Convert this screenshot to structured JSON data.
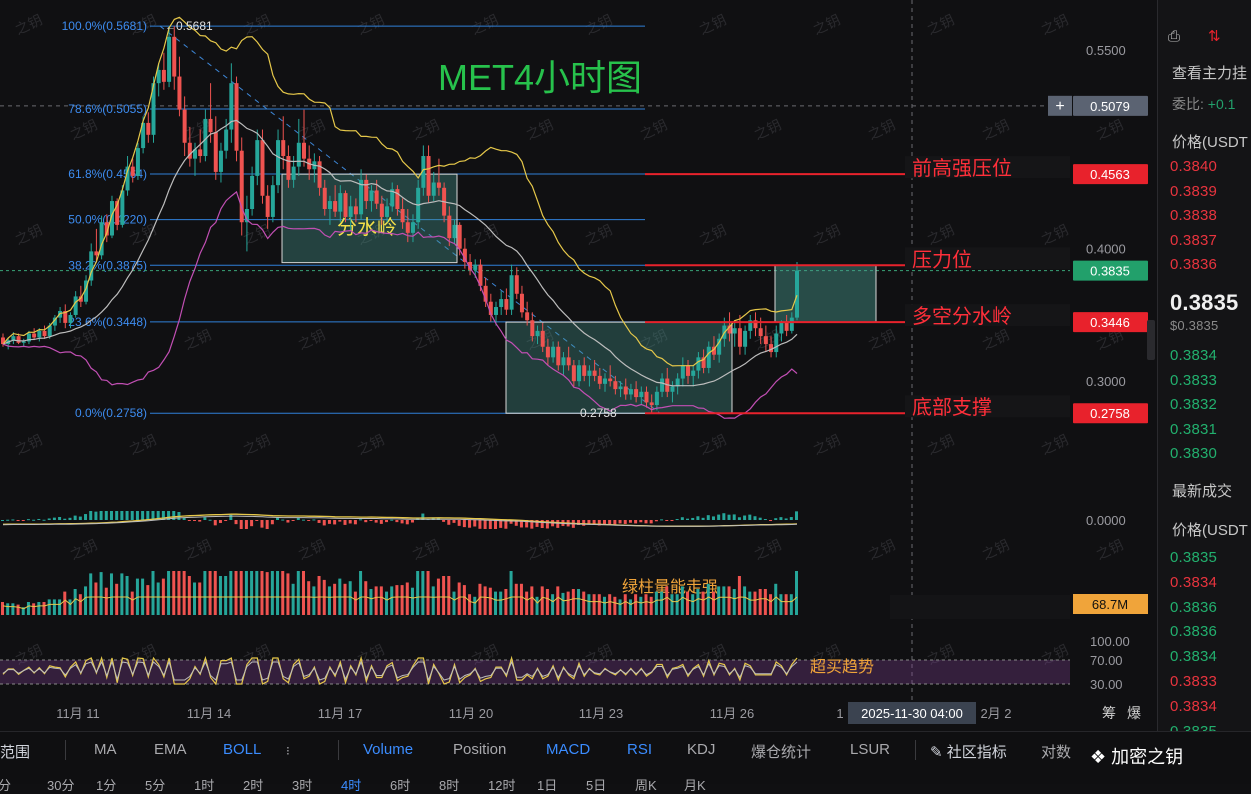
{
  "chart_data": {
    "type": "candlestick",
    "title": "MET4小时图",
    "y_axis": {
      "range": [
        0.2556,
        0.5742
      ],
      "tick_labels": [
        "0.5500",
        "0.4000",
        "0.3000"
      ],
      "ticks": [
        0.55,
        0.4,
        0.3
      ]
    },
    "x_axis": {
      "tick_labels": [
        "11月 11",
        "11月 14",
        "11月 17",
        "11月 20",
        "11月 23",
        "11月 26",
        "1",
        "2月 2"
      ],
      "crosshair_label": "2025-11-30 04:00"
    },
    "price_tags": [
      {
        "value": 0.5079,
        "label": "0.5079",
        "color": "#5b6372"
      },
      {
        "value": 0.4563,
        "label": "0.4563",
        "color": "#e8222c"
      },
      {
        "value": 0.3835,
        "label": "0.3835",
        "color": "#22a06b"
      },
      {
        "value": 0.3446,
        "label": "0.3446",
        "color": "#e8222c"
      },
      {
        "value": 0.2758,
        "label": "0.2758",
        "color": "#e8222c"
      }
    ],
    "fibonacci": [
      {
        "ratio": "100.0%",
        "value": 0.5681,
        "label": "100.0%(0.5681)"
      },
      {
        "ratio": "78.6%",
        "value": 0.5055,
        "label": "78.6%(0.5055)"
      },
      {
        "ratio": "61.8%",
        "value": 0.4564,
        "label": "61.8%(0.4564)"
      },
      {
        "ratio": "50.0%",
        "value": 0.422,
        "label": "50.0%(0.4220)"
      },
      {
        "ratio": "38.2%",
        "value": 0.3875,
        "label": "38.2%(0.3875)"
      },
      {
        "ratio": "23.6%",
        "value": 0.3448,
        "label": "23.6%(0.3448)"
      },
      {
        "ratio": "0.0%",
        "value": 0.2758,
        "label": "0.0%(0.2758)"
      }
    ],
    "high_marker": {
      "value": 0.5681,
      "label": "0.5681"
    },
    "low_marker": {
      "value": 0.2758,
      "label": "0.2758"
    },
    "levels": [
      {
        "value": 0.4563,
        "label": "前高强压位"
      },
      {
        "value": 0.3875,
        "label": "压力位"
      },
      {
        "value": 0.3446,
        "label": "多空分水岭"
      },
      {
        "value": 0.2758,
        "label": "底部支撑"
      }
    ],
    "boxes": [
      {
        "label": "分水岭",
        "y_top": 0.4563,
        "y_bottom": 0.3895
      },
      {
        "label": "",
        "y_top": 0.3446,
        "y_bottom": 0.2758
      },
      {
        "label": "",
        "y_top": 0.3875,
        "y_bottom": 0.3446
      }
    ],
    "candles_ohlc": [
      [
        0.333,
        0.336,
        0.326,
        0.328
      ],
      [
        0.328,
        0.333,
        0.324,
        0.331
      ],
      [
        0.331,
        0.337,
        0.328,
        0.334
      ],
      [
        0.334,
        0.336,
        0.328,
        0.329
      ],
      [
        0.329,
        0.332,
        0.326,
        0.33
      ],
      [
        0.33,
        0.338,
        0.328,
        0.336
      ],
      [
        0.336,
        0.34,
        0.331,
        0.333
      ],
      [
        0.333,
        0.34,
        0.33,
        0.338
      ],
      [
        0.338,
        0.342,
        0.332,
        0.334
      ],
      [
        0.334,
        0.344,
        0.332,
        0.342
      ],
      [
        0.342,
        0.35,
        0.338,
        0.348
      ],
      [
        0.348,
        0.356,
        0.344,
        0.353
      ],
      [
        0.353,
        0.358,
        0.34,
        0.344
      ],
      [
        0.344,
        0.352,
        0.34,
        0.35
      ],
      [
        0.35,
        0.368,
        0.348,
        0.364
      ],
      [
        0.364,
        0.372,
        0.356,
        0.36
      ],
      [
        0.36,
        0.38,
        0.358,
        0.376
      ],
      [
        0.376,
        0.404,
        0.372,
        0.398
      ],
      [
        0.398,
        0.415,
        0.39,
        0.395
      ],
      [
        0.395,
        0.425,
        0.392,
        0.42
      ],
      [
        0.42,
        0.426,
        0.405,
        0.41
      ],
      [
        0.41,
        0.44,
        0.408,
        0.436
      ],
      [
        0.436,
        0.438,
        0.414,
        0.418
      ],
      [
        0.418,
        0.448,
        0.416,
        0.444
      ],
      [
        0.444,
        0.47,
        0.44,
        0.462
      ],
      [
        0.462,
        0.468,
        0.45,
        0.455
      ],
      [
        0.455,
        0.48,
        0.452,
        0.476
      ],
      [
        0.476,
        0.5,
        0.472,
        0.495
      ],
      [
        0.495,
        0.503,
        0.48,
        0.486
      ],
      [
        0.486,
        0.53,
        0.48,
        0.525
      ],
      [
        0.525,
        0.54,
        0.515,
        0.535
      ],
      [
        0.535,
        0.548,
        0.52,
        0.526
      ],
      [
        0.526,
        0.568,
        0.522,
        0.56
      ],
      [
        0.56,
        0.568,
        0.52,
        0.53
      ],
      [
        0.53,
        0.545,
        0.5,
        0.505
      ],
      [
        0.505,
        0.515,
        0.47,
        0.48
      ],
      [
        0.48,
        0.492,
        0.462,
        0.468
      ],
      [
        0.468,
        0.48,
        0.455,
        0.475
      ],
      [
        0.475,
        0.49,
        0.465,
        0.47
      ],
      [
        0.47,
        0.505,
        0.466,
        0.498
      ],
      [
        0.498,
        0.525,
        0.48,
        0.488
      ],
      [
        0.488,
        0.5,
        0.452,
        0.458
      ],
      [
        0.458,
        0.48,
        0.45,
        0.474
      ],
      [
        0.474,
        0.498,
        0.468,
        0.49
      ],
      [
        0.49,
        0.54,
        0.48,
        0.525
      ],
      [
        0.525,
        0.53,
        0.466,
        0.474
      ],
      [
        0.474,
        0.484,
        0.41,
        0.42
      ],
      [
        0.42,
        0.44,
        0.398,
        0.43
      ],
      [
        0.43,
        0.462,
        0.425,
        0.455
      ],
      [
        0.455,
        0.49,
        0.448,
        0.482
      ],
      [
        0.482,
        0.49,
        0.434,
        0.44
      ],
      [
        0.44,
        0.448,
        0.415,
        0.424
      ],
      [
        0.424,
        0.455,
        0.42,
        0.448
      ],
      [
        0.448,
        0.49,
        0.442,
        0.482
      ],
      [
        0.482,
        0.5,
        0.46,
        0.47
      ],
      [
        0.47,
        0.478,
        0.446,
        0.452
      ],
      [
        0.452,
        0.47,
        0.446,
        0.462
      ],
      [
        0.462,
        0.498,
        0.455,
        0.48
      ],
      [
        0.48,
        0.505,
        0.462,
        0.468
      ],
      [
        0.468,
        0.478,
        0.452,
        0.46
      ],
      [
        0.46,
        0.472,
        0.45,
        0.466
      ],
      [
        0.466,
        0.47,
        0.44,
        0.446
      ],
      [
        0.446,
        0.452,
        0.425,
        0.43
      ],
      [
        0.43,
        0.44,
        0.418,
        0.436
      ],
      [
        0.436,
        0.448,
        0.424,
        0.428
      ],
      [
        0.428,
        0.448,
        0.42,
        0.442
      ],
      [
        0.442,
        0.444,
        0.42,
        0.424
      ],
      [
        0.424,
        0.44,
        0.414,
        0.432
      ],
      [
        0.432,
        0.438,
        0.42,
        0.426
      ],
      [
        0.426,
        0.46,
        0.422,
        0.452
      ],
      [
        0.452,
        0.456,
        0.43,
        0.436
      ],
      [
        0.436,
        0.448,
        0.428,
        0.444
      ],
      [
        0.444,
        0.452,
        0.43,
        0.434
      ],
      [
        0.434,
        0.44,
        0.418,
        0.424
      ],
      [
        0.424,
        0.438,
        0.42,
        0.432
      ],
      [
        0.432,
        0.45,
        0.428,
        0.445
      ],
      [
        0.445,
        0.448,
        0.425,
        0.43
      ],
      [
        0.43,
        0.438,
        0.415,
        0.42
      ],
      [
        0.42,
        0.43,
        0.405,
        0.412
      ],
      [
        0.412,
        0.426,
        0.405,
        0.42
      ],
      [
        0.42,
        0.452,
        0.415,
        0.446
      ],
      [
        0.446,
        0.478,
        0.44,
        0.47
      ],
      [
        0.47,
        0.478,
        0.435,
        0.44
      ],
      [
        0.44,
        0.458,
        0.436,
        0.45
      ],
      [
        0.45,
        0.468,
        0.44,
        0.446
      ],
      [
        0.446,
        0.45,
        0.42,
        0.425
      ],
      [
        0.425,
        0.432,
        0.402,
        0.408
      ],
      [
        0.408,
        0.422,
        0.404,
        0.418
      ],
      [
        0.418,
        0.42,
        0.395,
        0.4
      ],
      [
        0.4,
        0.408,
        0.385,
        0.39
      ],
      [
        0.39,
        0.396,
        0.38,
        0.384
      ],
      [
        0.384,
        0.392,
        0.378,
        0.388
      ],
      [
        0.388,
        0.392,
        0.368,
        0.372
      ],
      [
        0.372,
        0.378,
        0.356,
        0.36
      ],
      [
        0.36,
        0.366,
        0.345,
        0.35
      ],
      [
        0.35,
        0.36,
        0.342,
        0.356
      ],
      [
        0.356,
        0.368,
        0.35,
        0.362
      ],
      [
        0.362,
        0.37,
        0.35,
        0.354
      ],
      [
        0.354,
        0.388,
        0.35,
        0.38
      ],
      [
        0.38,
        0.386,
        0.362,
        0.366
      ],
      [
        0.366,
        0.372,
        0.348,
        0.352
      ],
      [
        0.352,
        0.36,
        0.342,
        0.346
      ],
      [
        0.346,
        0.352,
        0.33,
        0.334
      ],
      [
        0.334,
        0.342,
        0.328,
        0.338
      ],
      [
        0.338,
        0.344,
        0.322,
        0.326
      ],
      [
        0.326,
        0.332,
        0.312,
        0.318
      ],
      [
        0.318,
        0.33,
        0.314,
        0.326
      ],
      [
        0.326,
        0.33,
        0.308,
        0.312
      ],
      [
        0.312,
        0.322,
        0.305,
        0.318
      ],
      [
        0.318,
        0.326,
        0.308,
        0.312
      ],
      [
        0.312,
        0.316,
        0.296,
        0.3
      ],
      [
        0.3,
        0.316,
        0.296,
        0.312
      ],
      [
        0.312,
        0.318,
        0.3,
        0.304
      ],
      [
        0.304,
        0.312,
        0.296,
        0.308
      ],
      [
        0.308,
        0.316,
        0.3,
        0.304
      ],
      [
        0.304,
        0.31,
        0.294,
        0.298
      ],
      [
        0.298,
        0.306,
        0.292,
        0.302
      ],
      [
        0.302,
        0.312,
        0.296,
        0.3
      ],
      [
        0.3,
        0.304,
        0.29,
        0.294
      ],
      [
        0.294,
        0.3,
        0.288,
        0.296
      ],
      [
        0.296,
        0.302,
        0.286,
        0.29
      ],
      [
        0.29,
        0.298,
        0.286,
        0.294
      ],
      [
        0.294,
        0.3,
        0.284,
        0.288
      ],
      [
        0.288,
        0.296,
        0.282,
        0.292
      ],
      [
        0.292,
        0.296,
        0.28,
        0.284
      ],
      [
        0.284,
        0.29,
        0.276,
        0.282
      ],
      [
        0.282,
        0.296,
        0.278,
        0.292
      ],
      [
        0.292,
        0.306,
        0.288,
        0.302
      ],
      [
        0.302,
        0.31,
        0.288,
        0.292
      ],
      [
        0.292,
        0.3,
        0.284,
        0.296
      ],
      [
        0.296,
        0.306,
        0.29,
        0.302
      ],
      [
        0.302,
        0.318,
        0.296,
        0.312
      ],
      [
        0.312,
        0.316,
        0.298,
        0.304
      ],
      [
        0.304,
        0.312,
        0.296,
        0.308
      ],
      [
        0.308,
        0.322,
        0.302,
        0.318
      ],
      [
        0.318,
        0.324,
        0.306,
        0.31
      ],
      [
        0.31,
        0.33,
        0.306,
        0.326
      ],
      [
        0.326,
        0.334,
        0.316,
        0.32
      ],
      [
        0.32,
        0.336,
        0.314,
        0.332
      ],
      [
        0.332,
        0.348,
        0.326,
        0.342
      ],
      [
        0.342,
        0.352,
        0.33,
        0.336
      ],
      [
        0.336,
        0.346,
        0.326,
        0.34
      ],
      [
        0.34,
        0.35,
        0.32,
        0.326
      ],
      [
        0.326,
        0.342,
        0.32,
        0.338
      ],
      [
        0.338,
        0.35,
        0.332,
        0.346
      ],
      [
        0.346,
        0.352,
        0.334,
        0.34
      ],
      [
        0.34,
        0.348,
        0.328,
        0.334
      ],
      [
        0.334,
        0.342,
        0.322,
        0.328
      ],
      [
        0.328,
        0.334,
        0.318,
        0.322
      ],
      [
        0.322,
        0.342,
        0.318,
        0.336
      ],
      [
        0.336,
        0.346,
        0.33,
        0.344
      ],
      [
        0.344,
        0.35,
        0.334,
        0.338
      ],
      [
        0.338,
        0.352,
        0.336,
        0.348
      ],
      [
        0.348,
        0.39,
        0.346,
        0.3835
      ]
    ],
    "indicators": {
      "macd_zero_label": "0.0000",
      "volume_label": "68.7M",
      "rsi_ticks": [
        "100.00",
        "70.00",
        "30.00"
      ],
      "annotations": [
        "绿柱量能走强",
        "超买趋势"
      ]
    }
  },
  "orderbook": {
    "top_label": "查看主力挂",
    "ratio_label": "委比:",
    "ratio_value": "+0.1",
    "price_header": "价格(USDT",
    "asks": [
      "0.3840",
      "0.3839",
      "0.3838",
      "0.3837",
      "0.3836"
    ],
    "last_price": "0.3835",
    "last_price_sub": "$0.3835",
    "bids": [
      "0.3834",
      "0.3833",
      "0.3832",
      "0.3831",
      "0.3830"
    ],
    "trades_header": "最新成交",
    "trades_price_header": "价格(USDT",
    "trades": [
      {
        "price": "0.3835",
        "side": "buy"
      },
      {
        "price": "0.3834",
        "side": "sell"
      },
      {
        "price": "0.3836",
        "side": "buy"
      },
      {
        "price": "0.3836",
        "side": "buy"
      },
      {
        "price": "0.3834",
        "side": "buy"
      },
      {
        "price": "0.3833",
        "side": "sell"
      },
      {
        "price": "0.3834",
        "side": "sell"
      },
      {
        "price": "0.3835",
        "side": "buy"
      }
    ]
  },
  "toolbar": {
    "range_label": "范围",
    "indicator_items": [
      "MA",
      "EMA",
      "BOLL"
    ],
    "sub_items": [
      "Volume",
      "Position",
      "MACD",
      "RSI",
      "KDJ",
      "爆仓统计",
      "LSUR"
    ],
    "community_label": "社区指标",
    "log_label": "对数",
    "watermark_brand": "加密之钥",
    "intervals_row": [
      "分",
      "30分",
      "1分",
      "5分",
      "1时",
      "2时",
      "3时",
      "4时",
      "6时",
      "8时",
      "12时",
      "1日",
      "5日",
      "周K",
      "月K"
    ]
  },
  "right_axis_labels": [
    "筹",
    "爆"
  ],
  "watermark_text": "之钥"
}
